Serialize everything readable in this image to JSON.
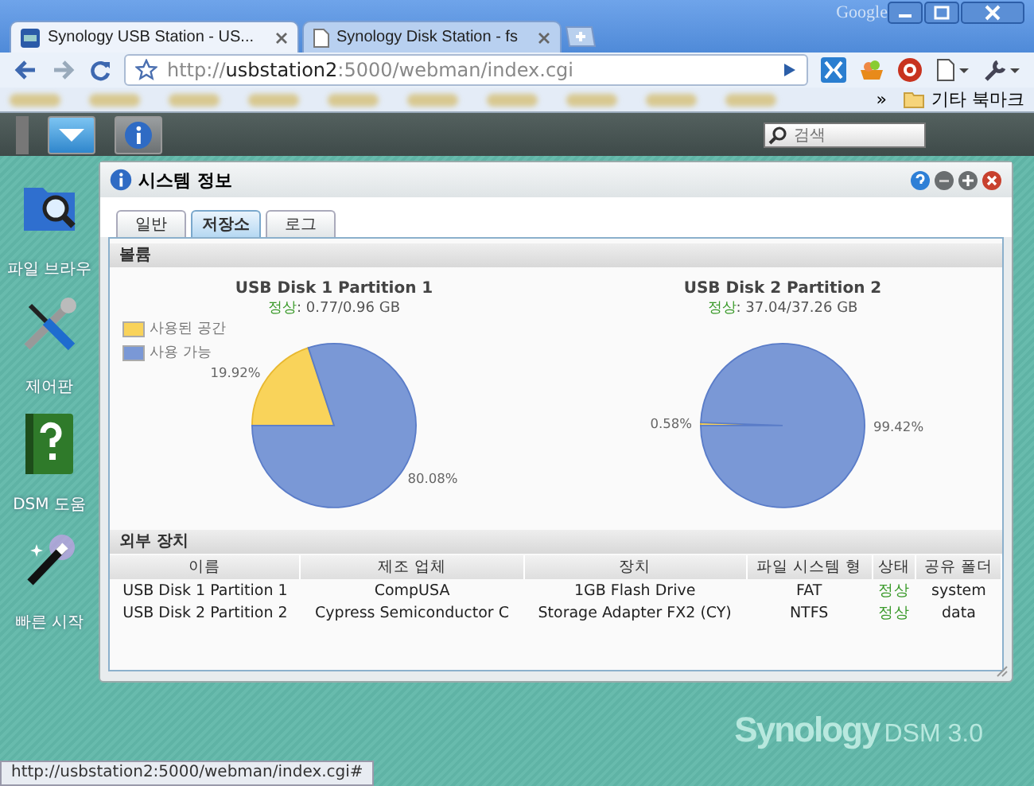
{
  "browser": {
    "brand": "Google",
    "tabs": [
      {
        "title": "Synology USB Station - US...",
        "selected": true
      },
      {
        "title": "Synology Disk Station - fs",
        "selected": false
      }
    ],
    "url": {
      "scheme": "http://",
      "host": "usbstation2",
      "rest": ":5000/webman/index.cgi"
    },
    "bookmarks_more": "»",
    "other_bookmarks": "기타 북마크"
  },
  "dsm": {
    "search_placeholder": "검색",
    "desktop_icons": [
      {
        "label": "파일 브라우",
        "kind": "file-browser"
      },
      {
        "label": "제어판",
        "kind": "control-panel"
      },
      {
        "label": "DSM 도움",
        "kind": "help"
      },
      {
        "label": "빠른 시작",
        "kind": "quick-start"
      }
    ],
    "watermark": {
      "brand": "Synology",
      "product": "DSM 3.0"
    }
  },
  "window": {
    "title": "시스템 정보",
    "tabs": [
      {
        "label": "일반",
        "selected": false
      },
      {
        "label": "저장소",
        "selected": true
      },
      {
        "label": "로그",
        "selected": false
      }
    ],
    "volume_section": "볼륨",
    "volumes": [
      {
        "name": "USB Disk 1 Partition 1",
        "status": "정상",
        "usage": ": 0.77/0.96 GB",
        "legend": [
          {
            "label": "사용된 공간",
            "color": "#f9d35a"
          },
          {
            "label": "사용 가능",
            "color": "#7a98d6"
          }
        ],
        "chart_data": {
          "type": "pie",
          "values": [
            19.92,
            80.08
          ],
          "value_labels": [
            "19.92%",
            "80.08%"
          ]
        }
      },
      {
        "name": "USB Disk 2 Partition 2",
        "status": "정상",
        "usage": ": 37.04/37.26 GB",
        "chart_data": {
          "type": "pie",
          "values": [
            0.58,
            99.42
          ],
          "value_labels": [
            "0.58%",
            "99.42%"
          ]
        }
      }
    ],
    "devices_section": "외부 장치",
    "table": {
      "columns": [
        "이름",
        "제조 업체",
        "장치",
        "파일 시스템 형",
        "상태",
        "공유 폴더"
      ],
      "rows": [
        [
          "USB Disk 1 Partition 1",
          "CompUSA",
          "1GB Flash Drive",
          "FAT",
          "정상",
          "system"
        ],
        [
          "USB Disk 2 Partition 2",
          "Cypress Semiconductor C",
          "Storage Adapter FX2 (CY)",
          "NTFS",
          "정상",
          "data"
        ]
      ]
    }
  },
  "status_bar": "http://usbstation2:5000/webman/index.cgi#"
}
